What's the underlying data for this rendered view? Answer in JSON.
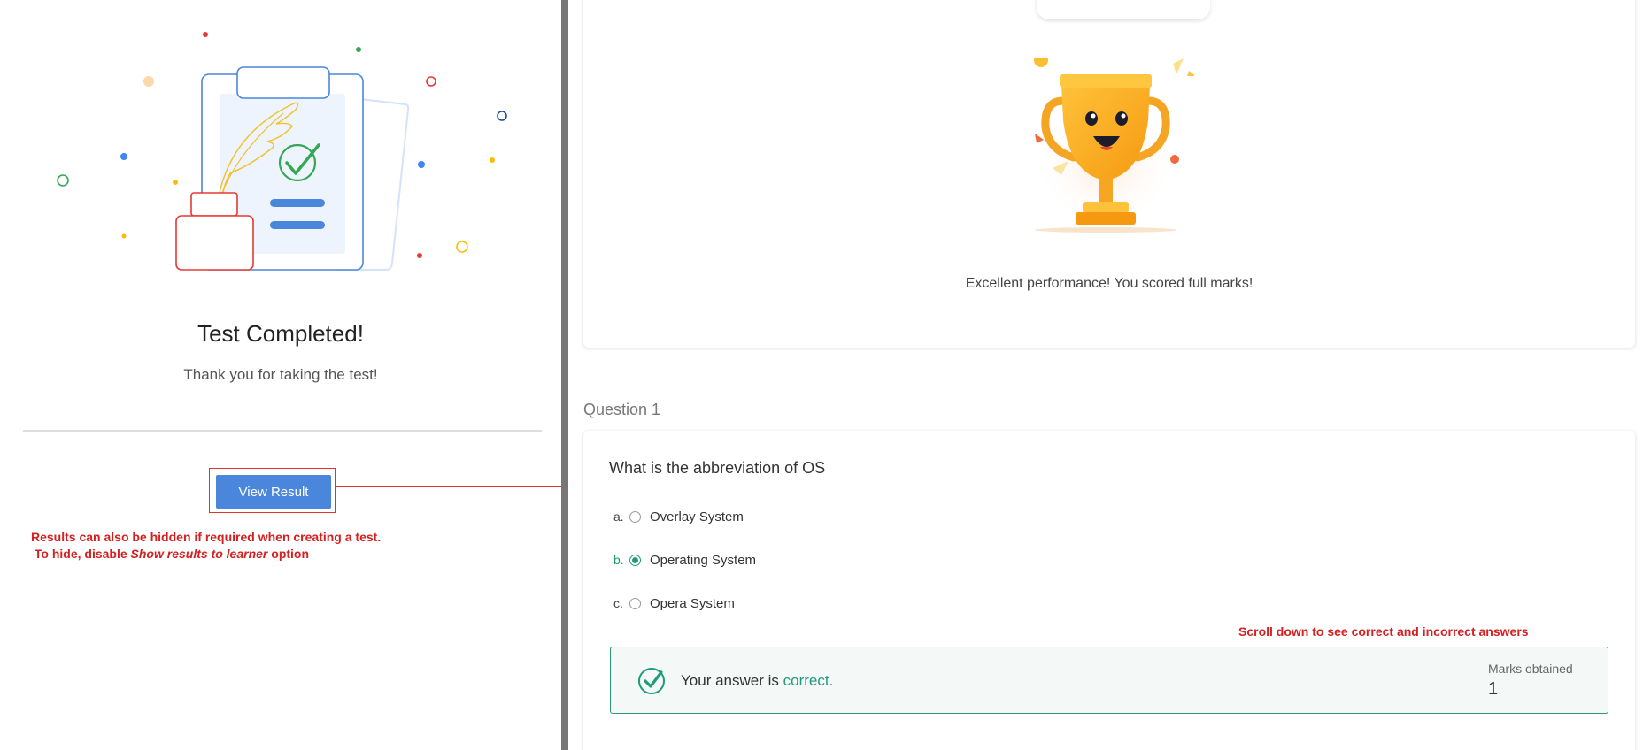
{
  "left_panel": {
    "title": "Test Completed!",
    "subtitle": "Thank you for taking the test!",
    "view_result_label": "View Result",
    "note_line1": "Results can also be hidden if required when creating a test.",
    "note_line2_prefix": " To hide, disable ",
    "note_line2_emph": "Show results to learner",
    "note_line2_suffix": " option"
  },
  "score_card": {
    "message": "Excellent performance! You scored full marks!"
  },
  "question": {
    "label": "Question 1",
    "text": "What is the abbreviation of OS",
    "options": [
      {
        "letter": "a.",
        "text": "Overlay System",
        "selected": false
      },
      {
        "letter": "b.",
        "text": "Operating System",
        "selected": true
      },
      {
        "letter": "c.",
        "text": "Opera System",
        "selected": false
      }
    ],
    "scroll_note": "Scroll down to see correct and incorrect answers",
    "answer_prefix": "Your answer is ",
    "answer_status": "correct.",
    "marks_label": "Marks obtained",
    "marks_value": "1"
  },
  "colors": {
    "accent": "#4a87dc",
    "correct": "#1e9c78",
    "annotation": "#d42020"
  }
}
